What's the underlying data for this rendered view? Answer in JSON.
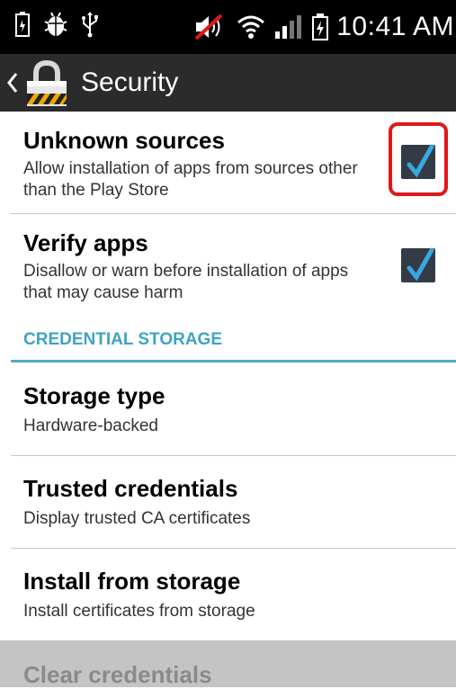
{
  "status_bar": {
    "time": "10:41 AM",
    "icons_left": [
      "battery-saver-icon",
      "android-debug-icon",
      "usb-icon"
    ],
    "icons_right": [
      "mute-icon",
      "wifi-icon",
      "signal-icon",
      "charging-battery-icon"
    ]
  },
  "action_bar": {
    "title": "Security",
    "icons": [
      "back-chevron-icon",
      "lock-icon"
    ]
  },
  "settings": {
    "unknown_sources": {
      "title": "Unknown sources",
      "summary": "Allow installation of apps from sources other than the Play Store",
      "checked": true
    },
    "verify_apps": {
      "title": "Verify apps",
      "summary": "Disallow or warn before installation of apps that may cause harm",
      "checked": true
    },
    "credential_storage_header": "CREDENTIAL STORAGE",
    "storage_type": {
      "title": "Storage type",
      "summary": "Hardware-backed"
    },
    "trusted_credentials": {
      "title": "Trusted credentials",
      "summary": "Display trusted CA certificates"
    },
    "install_from_storage": {
      "title": "Install from storage",
      "summary": "Install certificates from storage"
    },
    "clear_credentials": {
      "title": "Clear credentials",
      "enabled": false
    }
  },
  "colors": {
    "accent": "#3fa3c4",
    "highlight": "#e01818",
    "checkbox": "#333b47",
    "check_mark": "#39a7e0"
  }
}
